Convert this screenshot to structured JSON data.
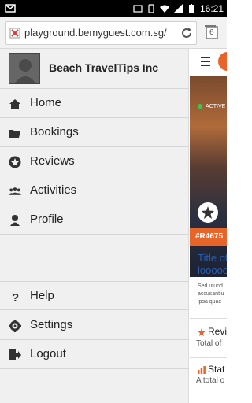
{
  "status_bar": {
    "time": "16:21"
  },
  "browser": {
    "url": "playground.bemyguest.com.sg/",
    "tab_count": "6"
  },
  "drawer": {
    "brand_name": "Beach TravelTips Inc",
    "nav_items": [
      {
        "label": "Home",
        "icon": "home-icon"
      },
      {
        "label": "Bookings",
        "icon": "folder-icon"
      },
      {
        "label": "Reviews",
        "icon": "star-badge-icon"
      },
      {
        "label": "Activities",
        "icon": "group-icon"
      },
      {
        "label": "Profile",
        "icon": "user-icon"
      }
    ],
    "bottom_items": [
      {
        "label": "Help",
        "icon": "help-icon"
      },
      {
        "label": "Settings",
        "icon": "gear-icon"
      },
      {
        "label": "Logout",
        "icon": "logout-icon"
      }
    ]
  },
  "content": {
    "status_badge": "ACTIVE",
    "code": "#R4675",
    "title": "Title of",
    "title_line2": "looooo",
    "desc_lines": [
      "Sed utund",
      "accusantiu",
      "ipsa quae"
    ],
    "reviews_title": "Revi",
    "reviews_sub": "Total of",
    "stats_title": "Stat",
    "stats_sub": "A total o"
  },
  "colors": {
    "accent": "#e8652a",
    "link": "#2a5db0",
    "drawer_bg": "#f0f0f0"
  }
}
